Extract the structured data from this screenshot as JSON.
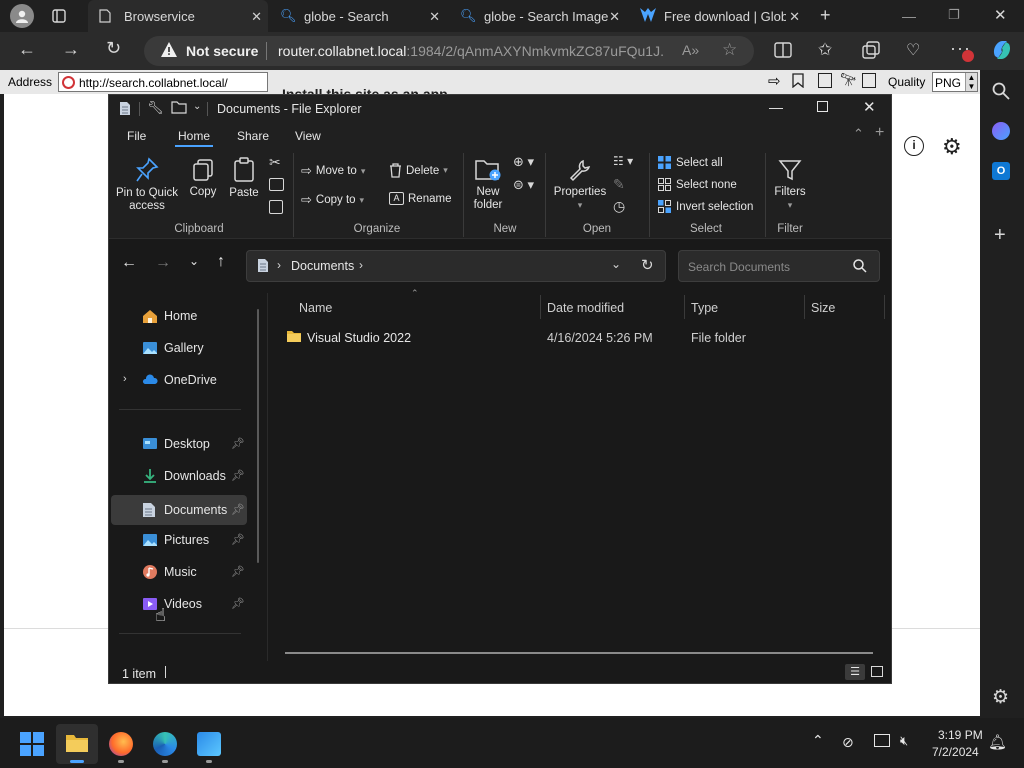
{
  "browser": {
    "tabs": [
      {
        "title": "Browservice",
        "active": true
      },
      {
        "title": "globe - Search"
      },
      {
        "title": "globe - Search Image"
      },
      {
        "title": "Free download | Glob"
      }
    ],
    "not_secure_label": "Not secure",
    "url_host": "router.collabnet.local",
    "url_path": ":1984/2/qAnmAXYNmkvmkZC87uFQu1J...",
    "ie_address_label": "Address",
    "ie_address_value": "http://search.collabnet.local/",
    "ie_quality_label": "Quality",
    "ie_quality_value": "PNG",
    "popup_text": "Install this site as an app"
  },
  "explorer": {
    "title": "Documents - File Explorer",
    "menu": {
      "file": "File",
      "home": "Home",
      "share": "Share",
      "view": "View"
    },
    "ribbon": {
      "pin_line1": "Pin to Quick",
      "pin_line2": "access",
      "copy": "Copy",
      "paste": "Paste",
      "clipboard": "Clipboard",
      "move_to": "Move to",
      "copy_to": "Copy to",
      "delete": "Delete",
      "rename": "Rename",
      "organize": "Organize",
      "new_folder_line1": "New",
      "new_folder_line2": "folder",
      "new": "New",
      "properties": "Properties",
      "open": "Open",
      "select_all": "Select all",
      "select_none": "Select none",
      "invert_selection": "Invert selection",
      "select": "Select",
      "filters": "Filters",
      "filter": "Filter"
    },
    "path": {
      "segment": "Documents"
    },
    "search_placeholder": "Search Documents",
    "nav": {
      "home": "Home",
      "gallery": "Gallery",
      "onedrive": "OneDrive",
      "desktop": "Desktop",
      "downloads": "Downloads",
      "documents": "Documents",
      "pictures": "Pictures",
      "music": "Music",
      "videos": "Videos"
    },
    "columns": {
      "name": "Name",
      "date": "Date modified",
      "type": "Type",
      "size": "Size"
    },
    "files": [
      {
        "name": "Visual Studio 2022",
        "date": "4/16/2024 5:26 PM",
        "type": "File folder",
        "size": ""
      }
    ],
    "status": "1 item"
  },
  "taskbar": {
    "time": "3:19 PM",
    "date": "7/2/2024"
  },
  "colors": {
    "accent": "#4aa3ff",
    "folder": "#e8b83a",
    "selected": "#3b3b3b"
  }
}
